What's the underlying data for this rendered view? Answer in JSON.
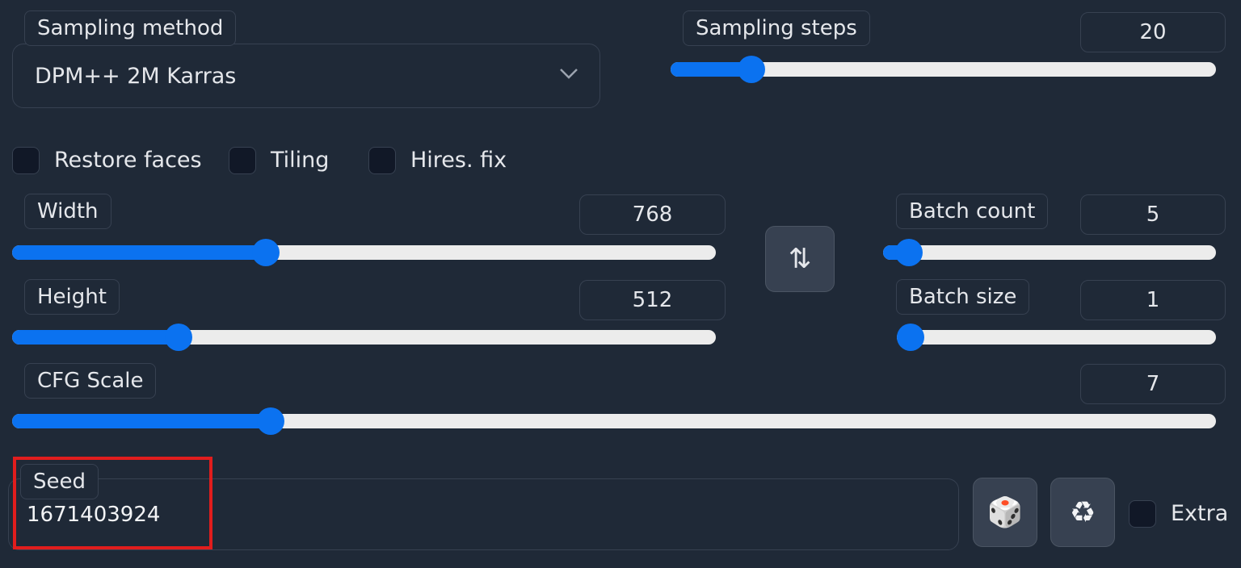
{
  "sampling_method": {
    "label": "Sampling method",
    "value": "DPM++ 2M Karras",
    "icon": "chevron-down-icon"
  },
  "sampling_steps": {
    "label": "Sampling steps",
    "value": "20",
    "fraction": 0.148
  },
  "checkboxes": {
    "restore_faces": "Restore faces",
    "tiling": "Tiling",
    "hires_fix": "Hires. fix"
  },
  "width": {
    "label": "Width",
    "value": "768",
    "fraction": 0.36
  },
  "height": {
    "label": "Height",
    "value": "512",
    "fraction": 0.237
  },
  "batch_count": {
    "label": "Batch count",
    "value": "5",
    "fraction": 0.078
  },
  "batch_size": {
    "label": "Batch size",
    "value": "1",
    "fraction": 0.0
  },
  "cfg_scale": {
    "label": "CFG Scale",
    "value": "7",
    "fraction": 0.215
  },
  "swap_button": {
    "glyph": "⇅",
    "icon": "swap-arrows-icon"
  },
  "seed": {
    "label": "Seed",
    "value": "1671403924",
    "random_button_glyph": "🎲",
    "reuse_button_glyph": "♻"
  },
  "extra": {
    "label": "Extra"
  },
  "colors": {
    "background": "#1f2937",
    "accent": "#0b72f0",
    "track": "#ececec",
    "highlight": "#e11d1d"
  }
}
